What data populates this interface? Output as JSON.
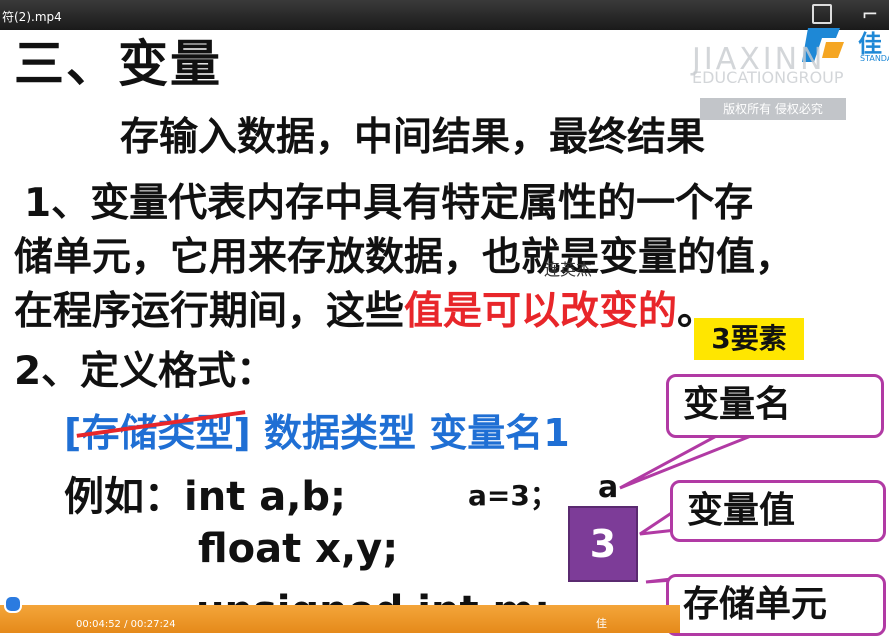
{
  "window": {
    "title": "符(2).mp4"
  },
  "watermark": {
    "en_top": "JIAXINN",
    "en_group": "EDUCATIONGROUP",
    "badge": "版权所有  侵权必究",
    "logo_cn": "佳",
    "logo_standard": "STANDARD"
  },
  "slide": {
    "heading": "三、变量",
    "subtitle": "存输入数据，中间结果，最终结果",
    "p1": "1、变量代表内存中具有特定属性的一个存",
    "p2": "储单元，它用来存放数据，也就是变量的值，",
    "p3_prefix": "在程序运行期间，这些",
    "p3_red": "值是可以改变的",
    "p3_suffix": "。",
    "author": "连英杰",
    "definition": "2、定义格式：",
    "format_struck": "[存储类型]",
    "format_rest": " 数据类型 变量名1",
    "example_prefix": "例如：int a,b;",
    "assignment": "a=3；",
    "var_a": "a",
    "float_line": "float x,y;",
    "unsigned_line": "unsigned int m;",
    "box_value": "3",
    "tag": "3要素",
    "callouts": [
      "变量名",
      "变量值",
      "存储单元"
    ]
  },
  "player": {
    "time": "00:04:52 / 00:27:24",
    "progress": 0.18
  },
  "colors": {
    "red": "#e8262a",
    "blue": "#1f6fd4",
    "purple": "#7d3c98",
    "callout_border": "#b13aa4",
    "tag_bg": "#ffe600"
  }
}
